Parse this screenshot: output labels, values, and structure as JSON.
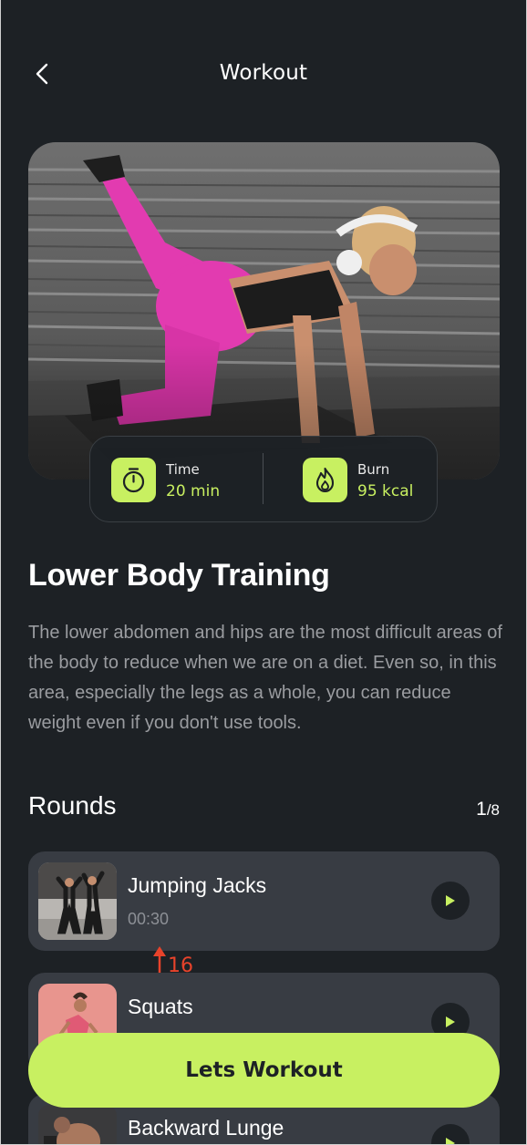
{
  "header": {
    "title": "Workout"
  },
  "hero": {
    "stats": {
      "time": {
        "label": "Time",
        "value": "20 min"
      },
      "burn": {
        "label": "Burn",
        "value": "95 kcal"
      }
    }
  },
  "workout": {
    "title": "Lower Body Training",
    "description": "The lower abdomen and hips are the most difficult areas of the body to reduce when we are on a diet. Even so, in this area, especially the legs as a whole, you can reduce weight even if you don't use tools."
  },
  "rounds": {
    "title": "Rounds",
    "current": "1",
    "total": "/8",
    "items": [
      {
        "name": "Jumping Jacks",
        "time": "00:30"
      },
      {
        "name": "Squats",
        "time": ""
      },
      {
        "name": "Backward Lunge",
        "time": ""
      }
    ]
  },
  "annotation": {
    "label": "16"
  },
  "cta": {
    "label": "Lets Workout"
  },
  "colors": {
    "accent": "#c8f061",
    "background": "#1d2125",
    "card": "#383c43",
    "annotation": "#e8432b"
  }
}
